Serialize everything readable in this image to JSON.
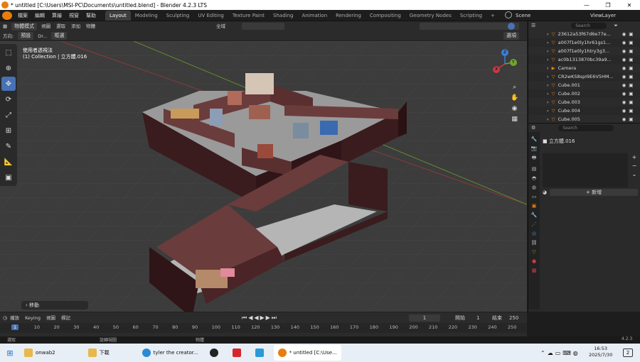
{
  "titlebar": {
    "title": "* untitled [C:\\Users\\MSI-PC\\Documents\\untitled.blend] - Blender 4.2.3 LTS",
    "minimize": "—",
    "maximize": "❐",
    "close": "✕"
  },
  "menu": [
    "檔案",
    "編輯",
    "算繪",
    "視窗",
    "幫助"
  ],
  "workspaces": [
    "Layout",
    "Modeling",
    "Sculpting",
    "UV Editing",
    "Texture Paint",
    "Shading",
    "Animation",
    "Rendering",
    "Compositing",
    "Geometry Nodes",
    "Scripting"
  ],
  "add_tab": "+",
  "scene": {
    "label": "Scene",
    "viewlayer": "ViewLayer"
  },
  "view_header": {
    "mode": "物體模式",
    "items": [
      "視圖",
      "選取",
      "添加",
      "物體"
    ],
    "transform": "全域"
  },
  "tool_header": {
    "orient_label": "方向:",
    "orient_value": "預設",
    "drag_label": "Dr...",
    "drag_value": "框選",
    "options": "選項"
  },
  "viewport": {
    "line1": "使用者透視法",
    "line2": "(1) Collection | 立方體.016",
    "operator": "移動"
  },
  "gizmo": {
    "x": "X",
    "y": "Y",
    "z": "Z"
  },
  "outliner": {
    "search_placeholder": "Search",
    "rows": [
      "23612a53f67d6e77e...",
      "a007f1e0ly1hr61gs1...",
      "a007f1e0ly1htry3g3...",
      "ac0b1313870bc39a9...",
      "Camera",
      "CR2wKS8spI9E6V5HM...",
      "Cube.001",
      "Cube.002",
      "Cube.003",
      "Cube.004",
      "Cube.005"
    ]
  },
  "properties": {
    "search_placeholder": "Search",
    "object_name": "立方體.016",
    "new_button": "新增",
    "add": "+",
    "remove": "−",
    "more": "⌄"
  },
  "timeline": {
    "playback": "播放",
    "keying": "Keying",
    "view": "視圖",
    "marker": "標記",
    "current_frame": "1",
    "start_label": "開始",
    "start": "1",
    "end_label": "結束",
    "end": "250"
  },
  "ruler": [
    "1",
    "10",
    "20",
    "30",
    "40",
    "50",
    "60",
    "70",
    "80",
    "90",
    "100",
    "110",
    "120",
    "130",
    "140",
    "150",
    "160",
    "170",
    "180",
    "190",
    "200",
    "210",
    "220",
    "230",
    "240",
    "250"
  ],
  "status": {
    "select": "選取",
    "rotate": "旋轉視圖",
    "object": "物體",
    "version": "4.2.3"
  },
  "taskbar": {
    "apps": [
      "onwab2",
      "下載",
      "tyler the creator...",
      "",
      "",
      "",
      "* untitled [C:\\Use..."
    ],
    "time": "16:53",
    "date": "2025/7/30",
    "notification": "2"
  },
  "colors": {
    "accent": "#4772b3",
    "x_axis": "#c83a44",
    "y_axis": "#6da72c",
    "z_axis": "#3b7ed8",
    "wall": "#3a1c1e",
    "wall_inner": "#6b3c3c"
  }
}
